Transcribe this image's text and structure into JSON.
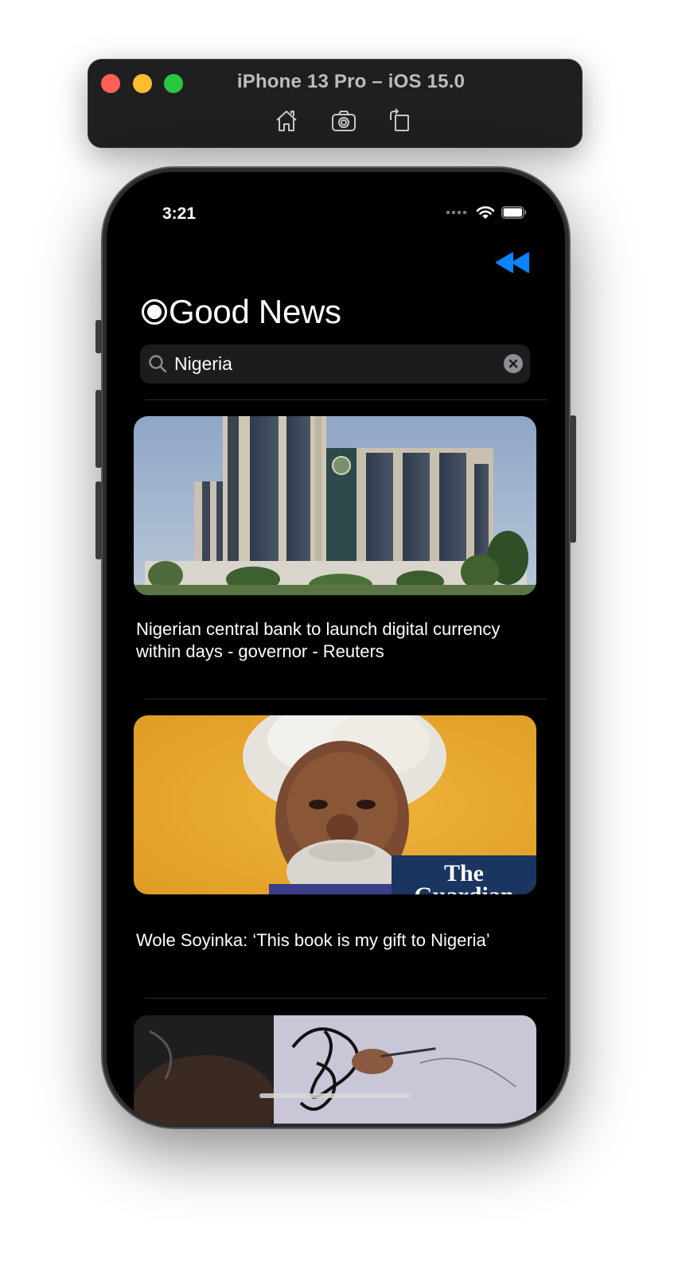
{
  "simulator": {
    "title": "iPhone 13 Pro – iOS 15.0",
    "tools": [
      "home-icon",
      "screenshot-icon",
      "rotate-icon"
    ]
  },
  "status_bar": {
    "time": "3:21"
  },
  "app": {
    "title": "Good News",
    "accent_color": "#0a84ff",
    "search": {
      "value": "Nigeria"
    },
    "articles": [
      {
        "title": "Nigerian central bank to launch digital currency within days - governor - Reuters",
        "image": "central-bank-building-photo"
      },
      {
        "title": "Wole Soyinka: ‘This book is my gift to Nigeria’",
        "image": "wole-soyinka-portrait-photo",
        "image_logo_text": "The Guardian"
      },
      {
        "title": "",
        "image": "artist-drawing-photo"
      }
    ]
  }
}
